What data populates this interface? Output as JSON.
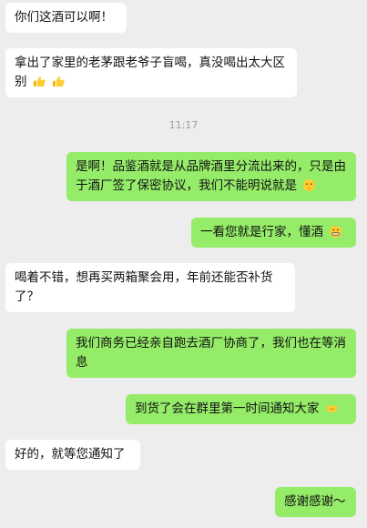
{
  "chat": {
    "messages": [
      {
        "id": "m1",
        "side": "in",
        "text": "你们这酒可以啊！"
      },
      {
        "id": "m2",
        "side": "in",
        "text": "拿出了家里的老茅跟老爷子盲喝，真没喝出太大区别",
        "emoji": [
          "thumbs-up-icon",
          "thumbs-up-icon"
        ]
      },
      {
        "id": "t1",
        "type": "time",
        "text": "11:17"
      },
      {
        "id": "m3",
        "side": "out",
        "text": "是啊！品鉴酒就是从品牌酒里分流出来的，只是由于酒厂签了保密协议，我们不能明说就是",
        "emoji": [
          "shushing-face-icon"
        ]
      },
      {
        "id": "m4",
        "side": "out",
        "text": "一看您就是行家，懂酒",
        "emoji": [
          "grimacing-face-icon"
        ]
      },
      {
        "id": "m5",
        "side": "in",
        "text": "喝着不错，想再买两箱聚会用，年前还能否补货了？"
      },
      {
        "id": "m6",
        "side": "out",
        "text": "我们商务已经亲自跑去酒厂协商了，我们也在等消息"
      },
      {
        "id": "m7",
        "side": "out",
        "text": "到货了会在群里第一时间通知大家",
        "emoji": [
          "handshake-icon"
        ]
      },
      {
        "id": "m8",
        "side": "in",
        "text": "好的，就等您通知了"
      },
      {
        "id": "m9",
        "side": "out",
        "text": "感谢感谢～"
      }
    ]
  },
  "colors": {
    "background": "#ededed",
    "incoming_bubble": "#ffffff",
    "outgoing_bubble": "#95ec69",
    "timestamp": "#9e9e9e"
  }
}
